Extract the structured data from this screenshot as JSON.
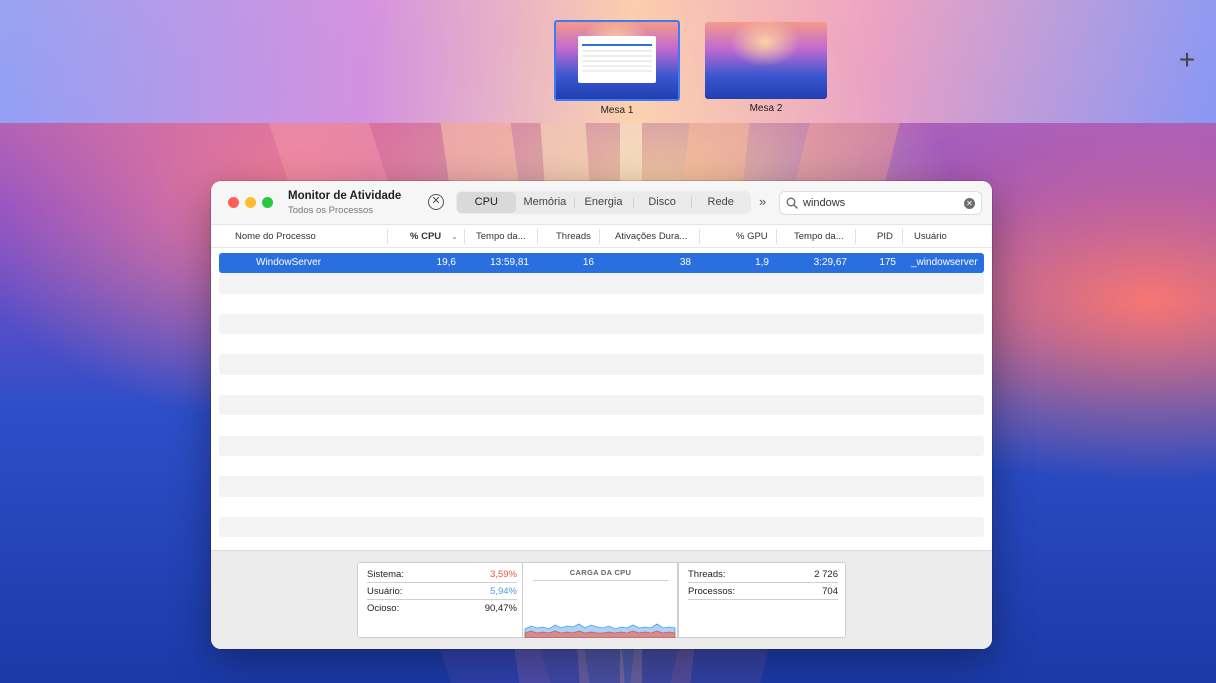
{
  "spaces": {
    "items": [
      {
        "label": "Mesa 1",
        "active": true
      },
      {
        "label": "Mesa 2",
        "active": false
      }
    ],
    "add_label": "+"
  },
  "window": {
    "title": "Monitor de Atividade",
    "subtitle": "Todos os Processos",
    "stop_icon": "x-circle-icon",
    "tabs": [
      "CPU",
      "Memória",
      "Energia",
      "Disco",
      "Rede"
    ],
    "active_tab": "CPU",
    "more_icon": "chevron-double-right-icon",
    "search": {
      "value": "windows",
      "icon": "magnifier-icon",
      "clear_icon": "x-fill-icon"
    }
  },
  "table": {
    "columns": [
      "Nome do Processo",
      "% CPU",
      "Tempo da...",
      "Threads",
      "Ativações Dura...",
      "% GPU",
      "Tempo da...",
      "PID",
      "Usuário"
    ],
    "sorted_column": "% CPU",
    "rows": [
      {
        "name": "WindowServer",
        "cpu": "19,6",
        "cpu_time": "13:59,81",
        "threads": "16",
        "wakeups": "38",
        "gpu": "1,9",
        "gpu_time": "3:29,67",
        "pid": "175",
        "user": "_windowserver"
      }
    ]
  },
  "footer": {
    "left": {
      "sistema_label": "Sistema:",
      "sistema_value": "3,59%",
      "usuario_label": "Usuário:",
      "usuario_value": "5,94%",
      "ocioso_label": "Ocioso:",
      "ocioso_value": "90,47%"
    },
    "chart_title": "CARGA DA CPU",
    "right": {
      "threads_label": "Threads:",
      "threads_value": "2 726",
      "processos_label": "Processos:",
      "processos_value": "704"
    },
    "colors": {
      "sistema": "#e8543f",
      "usuario": "#4a9cf0"
    }
  }
}
